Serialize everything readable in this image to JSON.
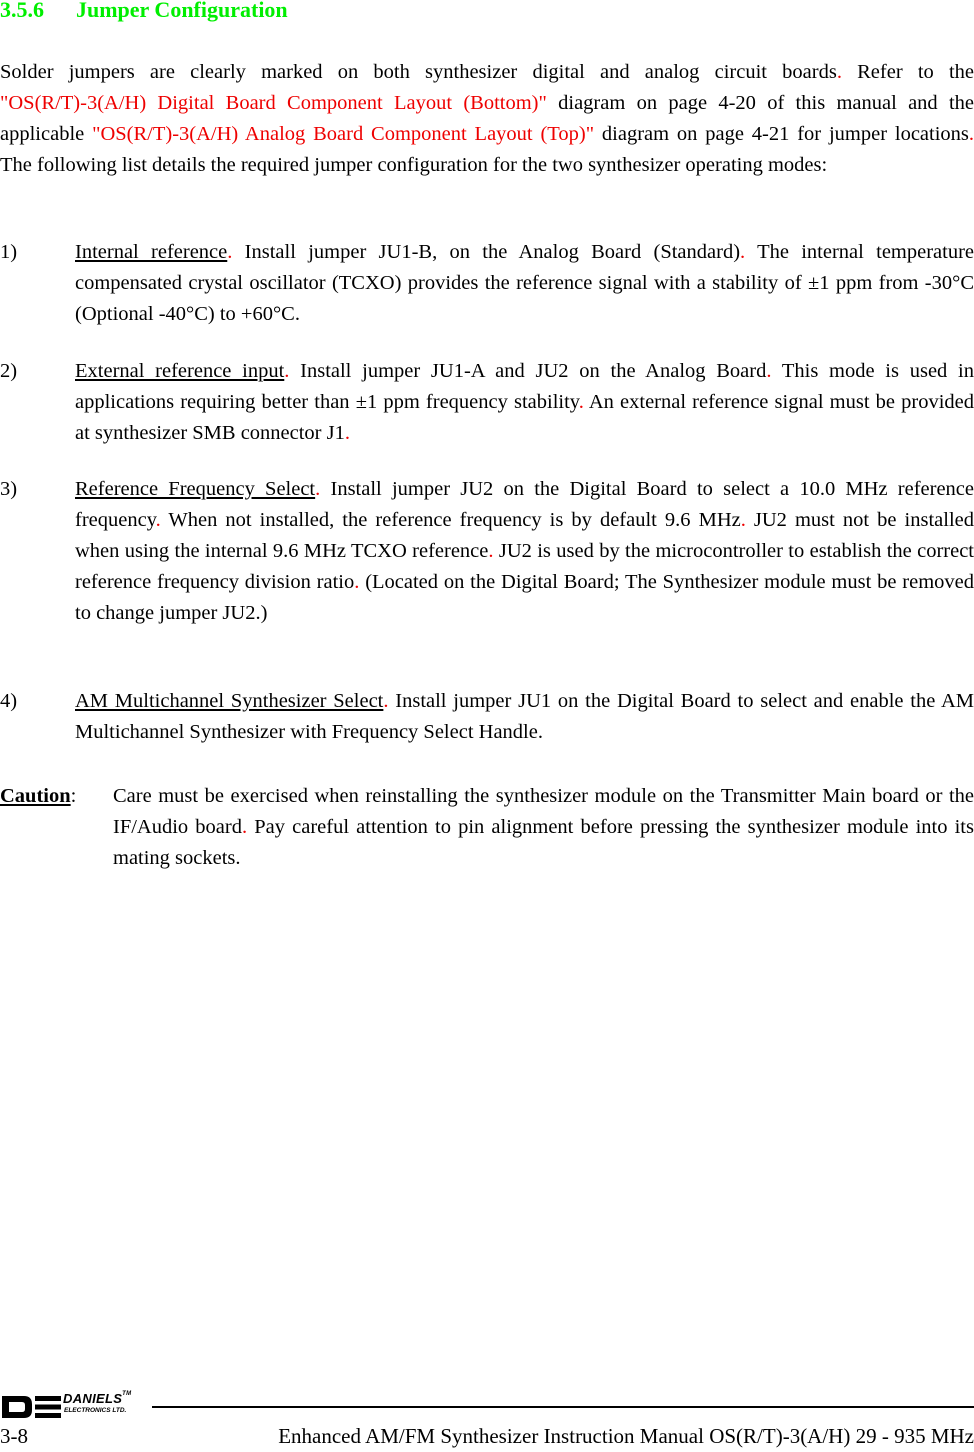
{
  "section": {
    "number": "3.5.6",
    "title": "Jumper Configuration",
    "color": "#00ee00"
  },
  "intro": {
    "part1": "Solder jumpers are clearly marked on both synthesizer digital and analog circuit boards",
    "dot1": ".",
    "part2": "  Refer to the ",
    "ref1": "\"OS(R/T)-3(A/H) Digital Board Component Layout (Bottom)\"",
    "part3": " diagram on page 4-20 of this manual and the applicable ",
    "ref2": "\"OS(R/T)-3(A/H) Analog Board Component Layout (Top)\"",
    "part4": " diagram on page 4-21 for jumper locations",
    "dot2": ".",
    "part5": "  The following list details the required jumper configuration for the two synthesizer operating modes:"
  },
  "items": [
    {
      "num": "1)",
      "title": "Internal reference",
      "dot": ".",
      "text_a": "  Install jumper JU1-B, on the Analog Board (Standard)",
      "dot_a": ".",
      "text_b": "  The internal temperature compensated crystal oscillator (TCXO) provides the reference signal with a stability of ±1 ppm from -30°C (Optional -40°C) to +60°C."
    },
    {
      "num": "2)",
      "title": "External reference input",
      "dot": ".",
      "text_a": "  Install jumper JU1-A and JU2 on the Analog Board",
      "dot_a": ".",
      "text_b": "  This mode is used in applications requiring better than ±1 ppm frequency stability",
      "dot_b": ".",
      "text_c": "  An external reference signal must be provided at synthesizer SMB connector J1",
      "dot_c": "."
    },
    {
      "num": "3)",
      "title": "Reference Frequency Select",
      "dot": ".",
      "text_a": "  Install jumper JU2 on the Digital Board to select a 10.0 MHz reference frequency",
      "dot_a": ".",
      "text_b": "  When not installed, the reference frequency is by default 9.6 MHz",
      "dot_b": ".",
      "text_c": "  JU2 must not be installed when using the internal 9.6 MHz TCXO reference",
      "dot_c": ".",
      "text_d": " JU2 is used by the microcontroller to establish the correct reference frequency division ratio",
      "dot_d": ".",
      "text_e": "  (Located on the Digital Board; The Synthesizer module must be removed to change jumper JU2.)"
    },
    {
      "num": "4)",
      "title": "AM Multichannel Synthesizer Select",
      "dot": ".",
      "text_a": "  Install jumper JU1 on the Digital Board to select and enable the AM Multichannel Synthesizer with Frequency Select Handle."
    }
  ],
  "caution": {
    "label": "Caution",
    "colon": ":",
    "text_a": "Care must be exercised when reinstalling the synthesizer module on the Transmitter Main board or the IF/Audio board",
    "dot_a": ".",
    "text_b": "  Pay careful attention to pin alignment before pressing the synthesizer module into its mating sockets."
  },
  "footer": {
    "logo_name": "DANIELS",
    "logo_tm": "TM",
    "logo_sub": "ELECTRONICS LTD.",
    "page_number": "3-8",
    "manual_title": "Enhanced AM/FM Synthesizer Instruction Manual OS(R/T)-3(A/H) 29 - 935 MHz"
  }
}
